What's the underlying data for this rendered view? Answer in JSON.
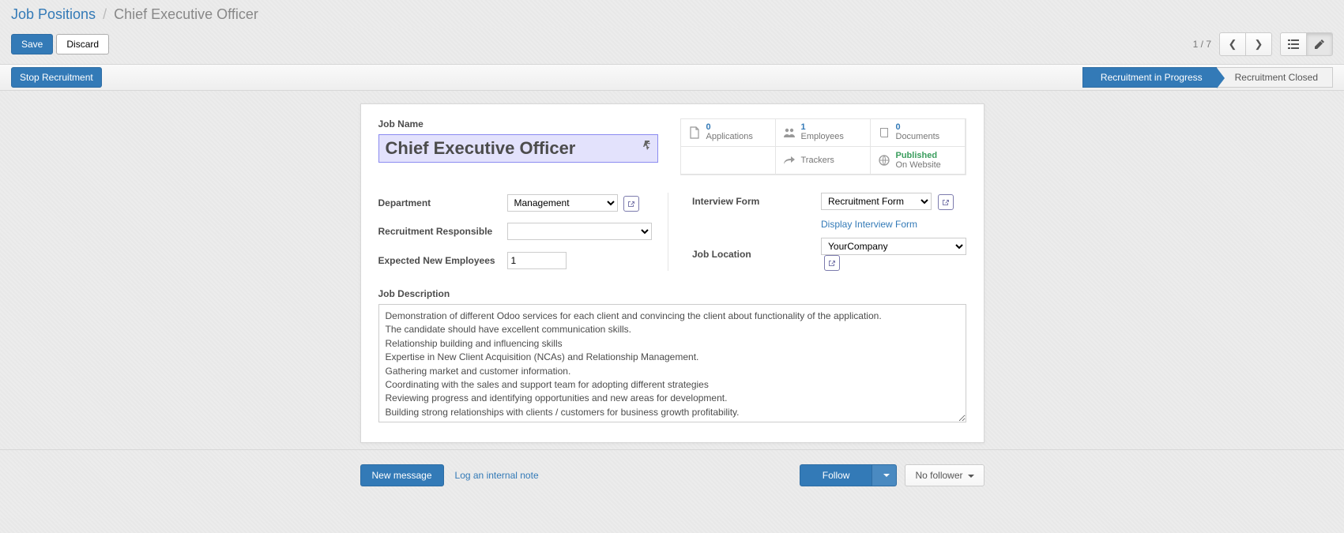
{
  "breadcrumb": {
    "root": "Job Positions",
    "current": "Chief Executive Officer"
  },
  "toolbar": {
    "save": "Save",
    "discard": "Discard"
  },
  "pager": {
    "text": "1 / 7"
  },
  "status": {
    "stop_button": "Stop Recruitment",
    "stages": {
      "in_progress": "Recruitment in Progress",
      "closed": "Recruitment Closed"
    }
  },
  "form": {
    "job_name_label": "Job Name",
    "job_name": "Chief Executive Officer",
    "stats": {
      "applications": {
        "count": "0",
        "label": "Applications"
      },
      "employees": {
        "count": "1",
        "label": "Employees"
      },
      "documents": {
        "count": "0",
        "label": "Documents"
      },
      "trackers": {
        "label": "Trackers"
      },
      "published": {
        "line1": "Published",
        "line2": "On Website"
      }
    },
    "fields": {
      "department": {
        "label": "Department",
        "value": "Management"
      },
      "responsible": {
        "label": "Recruitment Responsible",
        "value": ""
      },
      "expected": {
        "label": "Expected New Employees",
        "value": "1"
      },
      "interview_form": {
        "label": "Interview Form",
        "value": "Recruitment Form",
        "display_link": "Display Interview Form"
      },
      "location": {
        "label": "Job Location",
        "value": "YourCompany"
      }
    },
    "description": {
      "label": "Job Description",
      "text": "Demonstration of different Odoo services for each client and convincing the client about functionality of the application.\nThe candidate should have excellent communication skills.\nRelationship building and influencing skills\nExpertise in New Client Acquisition (NCAs) and Relationship Management.\nGathering market and customer information.\nCoordinating with the sales and support team for adopting different strategies\nReviewing progress and identifying opportunities and new areas for development.\nBuilding strong relationships with clients / customers for business growth profitability.\nKeep regular interaction with key clients for better extraction and expansion."
    }
  },
  "chatter": {
    "new_message": "New message",
    "log_note": "Log an internal note",
    "follow": "Follow",
    "no_follower": "No follower"
  }
}
